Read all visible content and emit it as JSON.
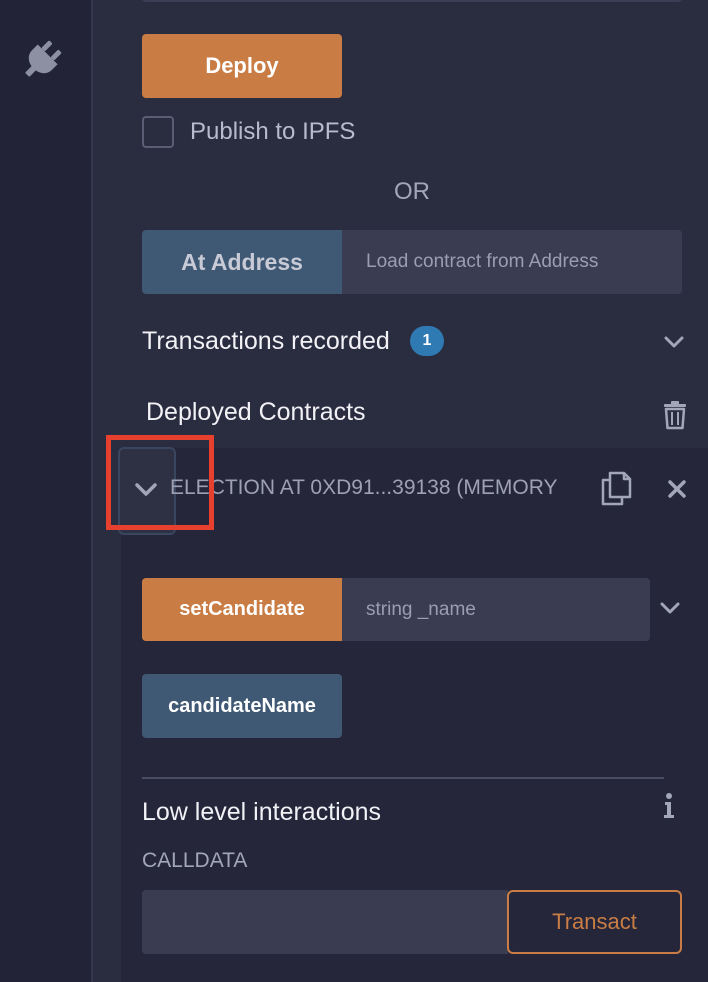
{
  "deploy": {
    "button_label": "Deploy",
    "publish_checkbox_label": "Publish to IPFS",
    "publish_checked": false,
    "or_label": "OR",
    "at_address_label": "At Address",
    "at_address_placeholder": "Load contract from Address"
  },
  "transactions": {
    "title": "Transactions recorded",
    "count": "1"
  },
  "deployed": {
    "title": "Deployed Contracts",
    "contract": {
      "name": "ELECTION AT 0XD91...39138 (MEMORY",
      "functions": [
        {
          "label": "setCandidate",
          "kind": "transact",
          "input_placeholder": "string _name"
        },
        {
          "label": "candidateName",
          "kind": "call"
        }
      ],
      "low_level": {
        "title": "Low level interactions",
        "calldata_label": "CALLDATA",
        "calldata_value": "",
        "transact_label": "Transact"
      }
    }
  },
  "icons": {
    "sidebar": "plug-icon",
    "transactions_toggle": "chevron-down-icon",
    "clear": "trash-icon",
    "contract_toggle": "chevron-down-icon",
    "copy": "copy-icon",
    "remove": "close-icon",
    "function_expand": "chevron-down-icon",
    "info": "info-icon"
  },
  "colors": {
    "transact_orange": "#c97d45",
    "call_blue": "#3f5874",
    "badge_blue": "#2f7ab2",
    "highlight_red": "#e8402f"
  }
}
